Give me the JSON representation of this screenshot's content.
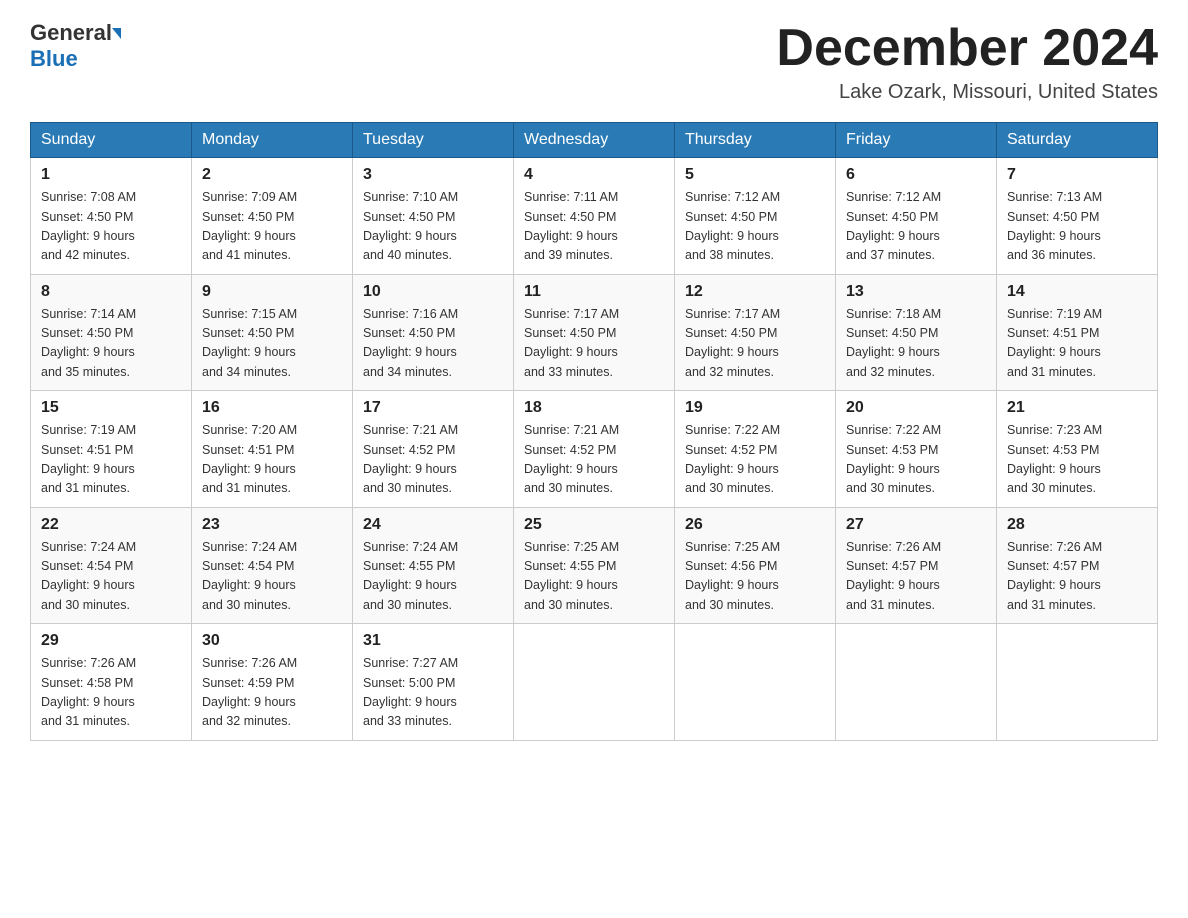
{
  "logo": {
    "general": "General",
    "blue": "Blue"
  },
  "title": {
    "month_year": "December 2024",
    "location": "Lake Ozark, Missouri, United States"
  },
  "weekdays": [
    "Sunday",
    "Monday",
    "Tuesday",
    "Wednesday",
    "Thursday",
    "Friday",
    "Saturday"
  ],
  "weeks": [
    [
      {
        "day": "1",
        "sunrise": "7:08 AM",
        "sunset": "4:50 PM",
        "daylight": "9 hours and 42 minutes."
      },
      {
        "day": "2",
        "sunrise": "7:09 AM",
        "sunset": "4:50 PM",
        "daylight": "9 hours and 41 minutes."
      },
      {
        "day": "3",
        "sunrise": "7:10 AM",
        "sunset": "4:50 PM",
        "daylight": "9 hours and 40 minutes."
      },
      {
        "day": "4",
        "sunrise": "7:11 AM",
        "sunset": "4:50 PM",
        "daylight": "9 hours and 39 minutes."
      },
      {
        "day": "5",
        "sunrise": "7:12 AM",
        "sunset": "4:50 PM",
        "daylight": "9 hours and 38 minutes."
      },
      {
        "day": "6",
        "sunrise": "7:12 AM",
        "sunset": "4:50 PM",
        "daylight": "9 hours and 37 minutes."
      },
      {
        "day": "7",
        "sunrise": "7:13 AM",
        "sunset": "4:50 PM",
        "daylight": "9 hours and 36 minutes."
      }
    ],
    [
      {
        "day": "8",
        "sunrise": "7:14 AM",
        "sunset": "4:50 PM",
        "daylight": "9 hours and 35 minutes."
      },
      {
        "day": "9",
        "sunrise": "7:15 AM",
        "sunset": "4:50 PM",
        "daylight": "9 hours and 34 minutes."
      },
      {
        "day": "10",
        "sunrise": "7:16 AM",
        "sunset": "4:50 PM",
        "daylight": "9 hours and 34 minutes."
      },
      {
        "day": "11",
        "sunrise": "7:17 AM",
        "sunset": "4:50 PM",
        "daylight": "9 hours and 33 minutes."
      },
      {
        "day": "12",
        "sunrise": "7:17 AM",
        "sunset": "4:50 PM",
        "daylight": "9 hours and 32 minutes."
      },
      {
        "day": "13",
        "sunrise": "7:18 AM",
        "sunset": "4:50 PM",
        "daylight": "9 hours and 32 minutes."
      },
      {
        "day": "14",
        "sunrise": "7:19 AM",
        "sunset": "4:51 PM",
        "daylight": "9 hours and 31 minutes."
      }
    ],
    [
      {
        "day": "15",
        "sunrise": "7:19 AM",
        "sunset": "4:51 PM",
        "daylight": "9 hours and 31 minutes."
      },
      {
        "day": "16",
        "sunrise": "7:20 AM",
        "sunset": "4:51 PM",
        "daylight": "9 hours and 31 minutes."
      },
      {
        "day": "17",
        "sunrise": "7:21 AM",
        "sunset": "4:52 PM",
        "daylight": "9 hours and 30 minutes."
      },
      {
        "day": "18",
        "sunrise": "7:21 AM",
        "sunset": "4:52 PM",
        "daylight": "9 hours and 30 minutes."
      },
      {
        "day": "19",
        "sunrise": "7:22 AM",
        "sunset": "4:52 PM",
        "daylight": "9 hours and 30 minutes."
      },
      {
        "day": "20",
        "sunrise": "7:22 AM",
        "sunset": "4:53 PM",
        "daylight": "9 hours and 30 minutes."
      },
      {
        "day": "21",
        "sunrise": "7:23 AM",
        "sunset": "4:53 PM",
        "daylight": "9 hours and 30 minutes."
      }
    ],
    [
      {
        "day": "22",
        "sunrise": "7:24 AM",
        "sunset": "4:54 PM",
        "daylight": "9 hours and 30 minutes."
      },
      {
        "day": "23",
        "sunrise": "7:24 AM",
        "sunset": "4:54 PM",
        "daylight": "9 hours and 30 minutes."
      },
      {
        "day": "24",
        "sunrise": "7:24 AM",
        "sunset": "4:55 PM",
        "daylight": "9 hours and 30 minutes."
      },
      {
        "day": "25",
        "sunrise": "7:25 AM",
        "sunset": "4:55 PM",
        "daylight": "9 hours and 30 minutes."
      },
      {
        "day": "26",
        "sunrise": "7:25 AM",
        "sunset": "4:56 PM",
        "daylight": "9 hours and 30 minutes."
      },
      {
        "day": "27",
        "sunrise": "7:26 AM",
        "sunset": "4:57 PM",
        "daylight": "9 hours and 31 minutes."
      },
      {
        "day": "28",
        "sunrise": "7:26 AM",
        "sunset": "4:57 PM",
        "daylight": "9 hours and 31 minutes."
      }
    ],
    [
      {
        "day": "29",
        "sunrise": "7:26 AM",
        "sunset": "4:58 PM",
        "daylight": "9 hours and 31 minutes."
      },
      {
        "day": "30",
        "sunrise": "7:26 AM",
        "sunset": "4:59 PM",
        "daylight": "9 hours and 32 minutes."
      },
      {
        "day": "31",
        "sunrise": "7:27 AM",
        "sunset": "5:00 PM",
        "daylight": "9 hours and 33 minutes."
      },
      null,
      null,
      null,
      null
    ]
  ],
  "labels": {
    "sunrise": "Sunrise:",
    "sunset": "Sunset:",
    "daylight": "Daylight:"
  }
}
